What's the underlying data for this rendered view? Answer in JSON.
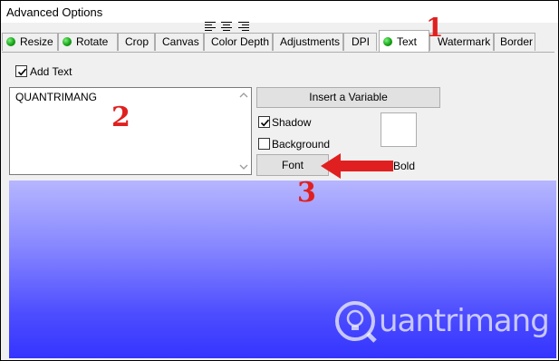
{
  "window": {
    "title": "Advanced Options"
  },
  "tabs": [
    {
      "label": "Resize",
      "has_status": true
    },
    {
      "label": "Rotate",
      "has_status": true
    },
    {
      "label": "Crop"
    },
    {
      "label": "Canvas"
    },
    {
      "label": "Color Depth"
    },
    {
      "label": "Adjustments"
    },
    {
      "label": "DPI"
    },
    {
      "label": "Text",
      "has_status": true,
      "active": true
    },
    {
      "label": "Watermark"
    },
    {
      "label": "Border"
    }
  ],
  "text_tab": {
    "add_text_label": "Add Text",
    "add_text_checked": true,
    "text_value": "QUANTRIMANG",
    "insert_variable_label": "Insert a Variable",
    "shadow_label": "Shadow",
    "shadow_checked": true,
    "background_label": "Background",
    "background_checked": false,
    "font_button_label": "Font",
    "font_style_label": "Bold",
    "color_swatch": "#ffffff"
  },
  "annotations": {
    "step1": "1",
    "step2": "2",
    "step3": "3",
    "color": "#e02020"
  },
  "watermark": {
    "text": "uantrimang"
  },
  "status_color": "#17a317",
  "preview_color": "#4d4dff"
}
